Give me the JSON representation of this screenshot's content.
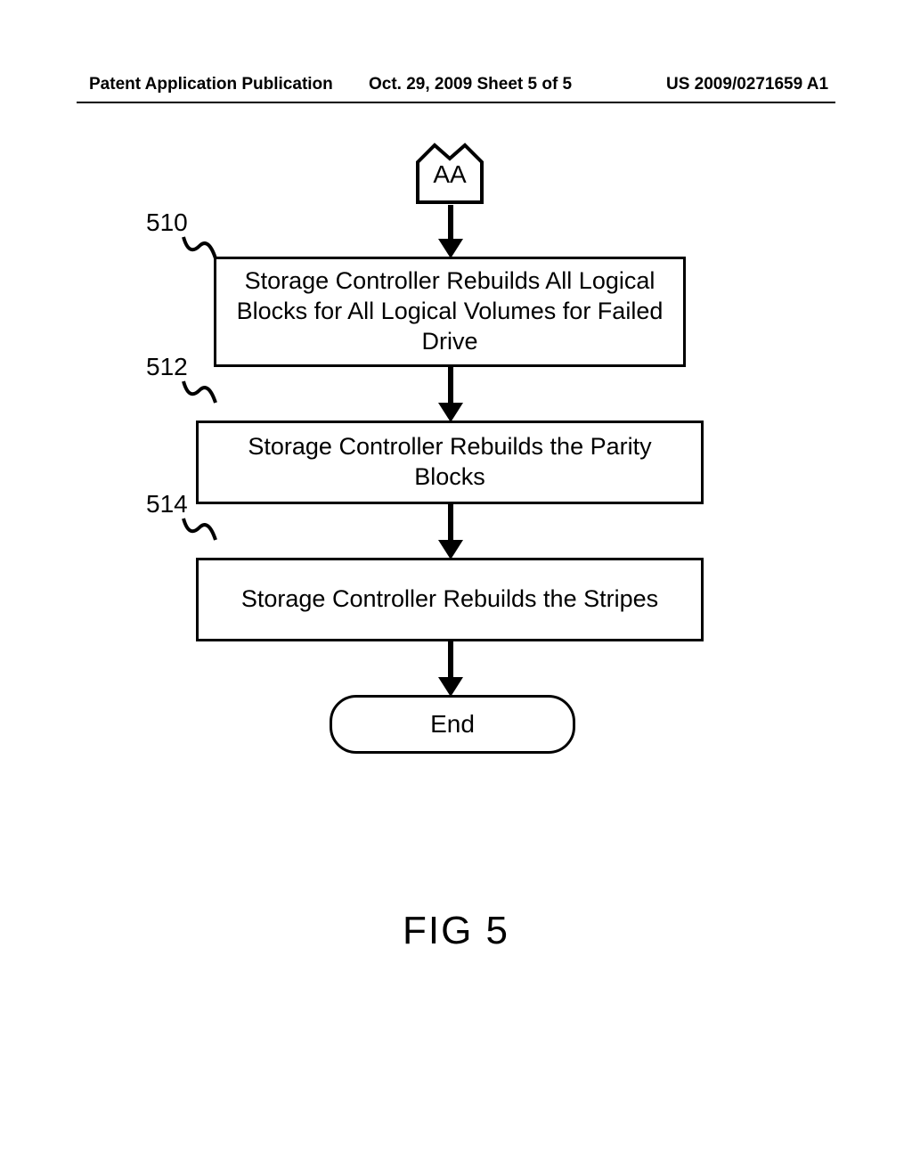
{
  "header": {
    "left": "Patent Application Publication",
    "center": "Oct. 29, 2009  Sheet 5 of 5",
    "right": "US 2009/0271659 A1"
  },
  "steps": [
    {
      "label": "510",
      "text": "Storage Controller Rebuilds All Logical Blocks for All Logical Volumes for Failed Drive"
    },
    {
      "label": "512",
      "text": "Storage Controller Rebuilds the Parity Blocks"
    },
    {
      "label": "514",
      "text": "Storage Controller Rebuilds the Stripes"
    }
  ],
  "start_label": "AA",
  "end_label": "End",
  "figure_label": "FIG 5"
}
